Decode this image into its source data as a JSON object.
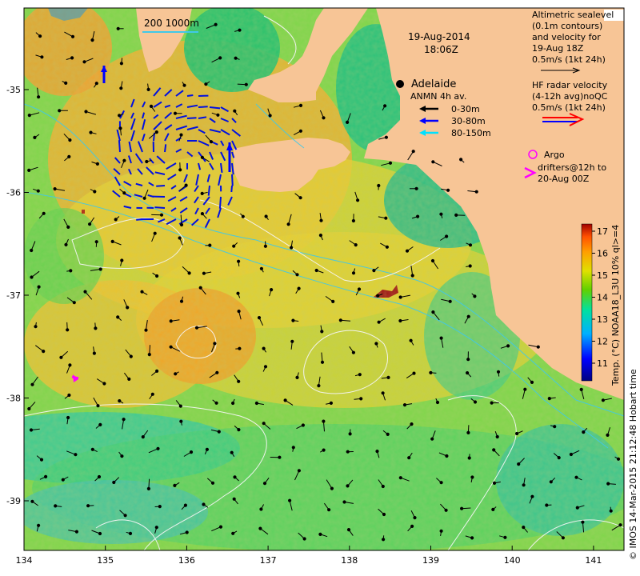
{
  "map": {
    "date": "19-Aug-2014",
    "time": "18:06Z",
    "city": "Adelaide",
    "scale_label": "200  1000m",
    "lon_ticks": [
      "134",
      "135",
      "136",
      "137",
      "138",
      "139",
      "140",
      "141"
    ],
    "lat_ticks": [
      "-35",
      "-36",
      "-37",
      "-38",
      "-39"
    ],
    "footer": "© IMOS 14-Mar-2015 21:12:48 Hobart time"
  },
  "legend": {
    "altimetric_lines": [
      "Altimetric sealevel",
      "(0.1m contours)",
      "and velocity for",
      "19-Aug 18Z",
      "0.5m/s (1kt 24h)"
    ],
    "hf_lines": [
      "HF radar velocity",
      "(4-12h avg)noQC",
      "0.5m/s (1kt 24h)"
    ],
    "anmn_title": "ANMN 4h av.",
    "anmn_items": [
      {
        "label": "0-30m",
        "color": "#000000"
      },
      {
        "label": "30-80m",
        "color": "#0000ff"
      },
      {
        "label": "80-150m",
        "color": "#00e0ff"
      }
    ],
    "argo_label": "Argo",
    "drifter_lines": [
      "drifters@12h to",
      "20-Aug 00Z"
    ],
    "colorbar_label": "Temp. (°C) NOAA18_L3U 10% ql>=4",
    "colorbar_ticks": [
      "11",
      "12",
      "13",
      "14",
      "15",
      "16",
      "17"
    ]
  },
  "colors": {
    "land": "#f7c596",
    "argo": "#ff00ff",
    "radar_red": "#ff0000",
    "radar_blue": "#0000ff"
  }
}
